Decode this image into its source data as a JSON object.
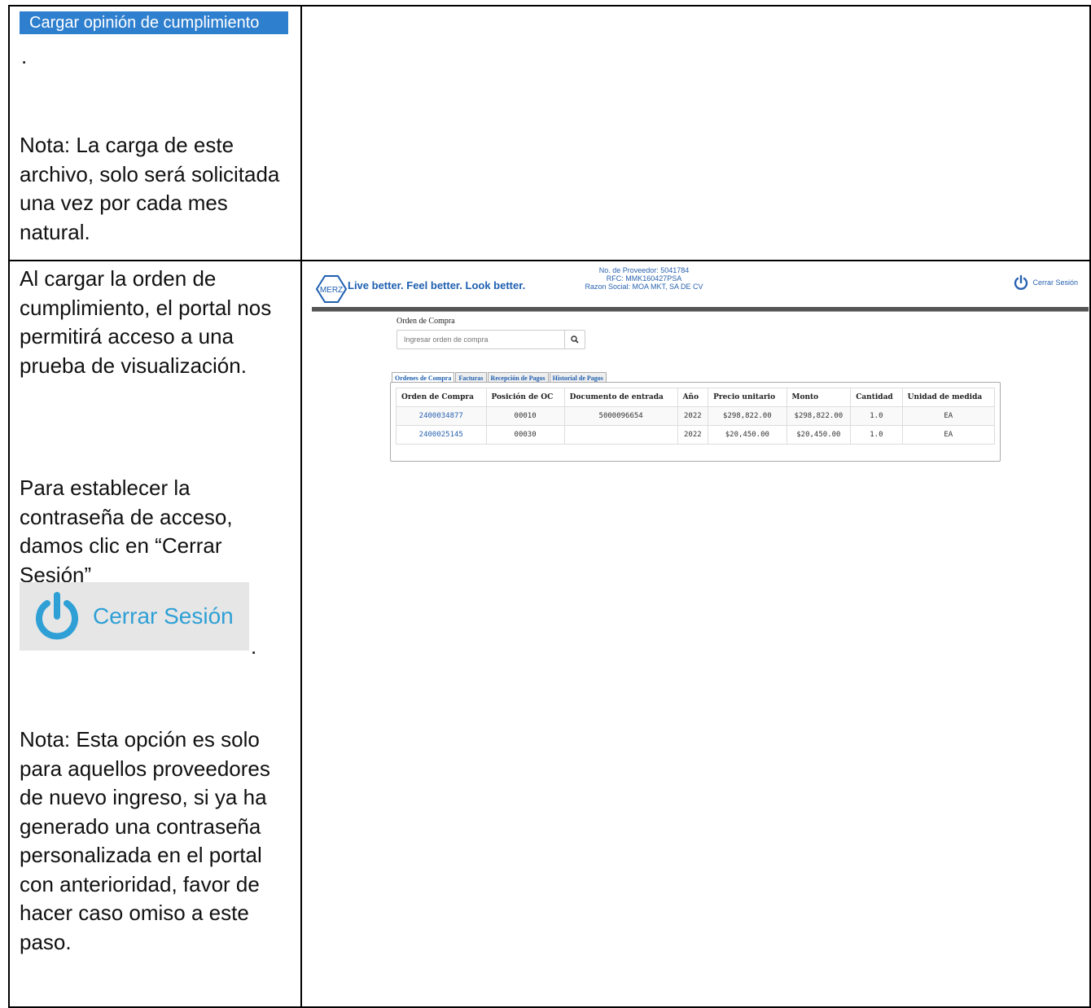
{
  "step1": {
    "upload_button": "Cargar opinión de cumplimiento",
    "dot": ".",
    "note": "Nota: La carga de este archivo, solo será solicitada una vez por cada mes natural."
  },
  "step2": {
    "intro": "Al cargar la orden de cumplimiento, el portal nos permitirá acceso a una prueba de visualización.",
    "instruction": "Para establecer la contraseña de acceso, damos clic en “Cerrar Sesión”",
    "logout_image_label": "Cerrar Sesión",
    "dot": ".",
    "note": "Nota: Esta opción es solo para aquellos proveedores de nuevo ingreso, si ya ha generado una contraseña personalizada en el portal con anterioridad, favor de hacer caso omiso a este paso."
  },
  "portal": {
    "logo_text": "MERZ",
    "tagline": "Live better. Feel better. Look better.",
    "supplier_number": "No. de Proveedor: 5041784",
    "rfc": "RFC: MMK160427PSA",
    "razon_social": "Razon Social: MOA MKT, SA DE CV",
    "logout_label": "Cerrar Sesión",
    "search_label": "Orden de Compra",
    "search_placeholder": "Ingresar orden de compra",
    "tabs": [
      "Ordenes de Compra",
      "Facturas",
      "Recepción de Pagos",
      "Historial de Pagos"
    ],
    "table": {
      "headers": [
        "Orden de Compra",
        "Posición de OC",
        "Documento de entrada",
        "Año",
        "Precio unitario",
        "Monto",
        "Cantidad",
        "Unidad de medida"
      ],
      "rows": [
        [
          "2400034877",
          "00010",
          "5000096654",
          "2022",
          "$298,822.00",
          "$298,822.00",
          "1.0",
          "EA"
        ],
        [
          "2400025145",
          "00030",
          "",
          "2022",
          "$20,450.00",
          "$20,450.00",
          "1.0",
          "EA"
        ]
      ]
    },
    "colors": {
      "accent": "#2a62b0",
      "power_icon": "#2ea0d6"
    }
  }
}
